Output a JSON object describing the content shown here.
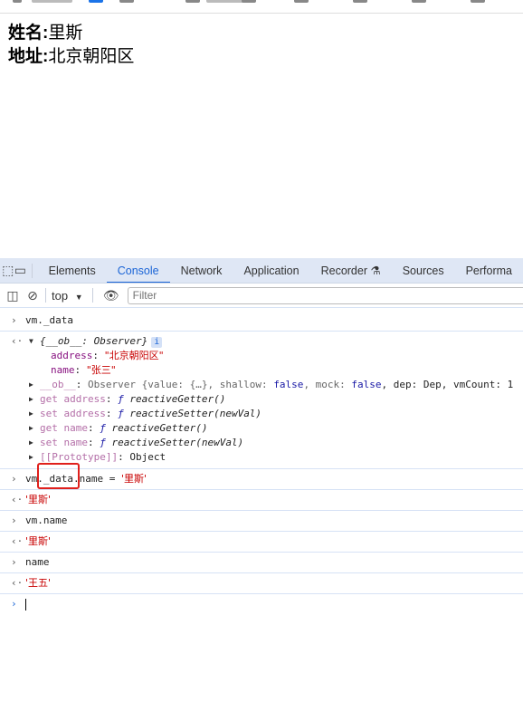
{
  "page": {
    "name_label": "姓名:",
    "name_value": "里斯",
    "address_label": "地址:",
    "address_value": "北京朝阳区"
  },
  "devtools": {
    "tabs": [
      "Elements",
      "Console",
      "Network",
      "Application",
      "Recorder",
      "Sources",
      "Performa"
    ],
    "active_tab": "Console",
    "context": "top",
    "filter_placeholder": "Filter",
    "console": {
      "cmd1": "vm._data",
      "obj_head": "{__ob__: Observer}",
      "address_key": "address",
      "address_val": "\"北京朝阳区\"",
      "name_key": "name",
      "name_val": "\"张三\"",
      "ob_key": "__ob__",
      "ob_val_pre": "Observer {value: {…}, shallow: ",
      "false1": "false",
      "mock": ", mock: ",
      "false2": "false",
      "ob_val_post": ", dep: Dep, vmCount: 1",
      "get_address": "get address",
      "getter": "reactiveGetter()",
      "set_address": "set address",
      "setter": "reactiveSetter(newVal)",
      "get_name": "get name",
      "set_name": "set name",
      "proto_key": "[[Prototype]]",
      "proto_val": "Object",
      "cmd2_pre": "vm._data.name = ",
      "cmd2_val": "'里斯'",
      "res2": "'里斯'",
      "cmd3": "vm.name",
      "res3": "'里斯'",
      "cmd4": "name",
      "res4": "'王五'"
    }
  },
  "colors": {
    "accent": "#1a64d6",
    "highlight_box": "#e0201c",
    "string": "#c80000"
  }
}
